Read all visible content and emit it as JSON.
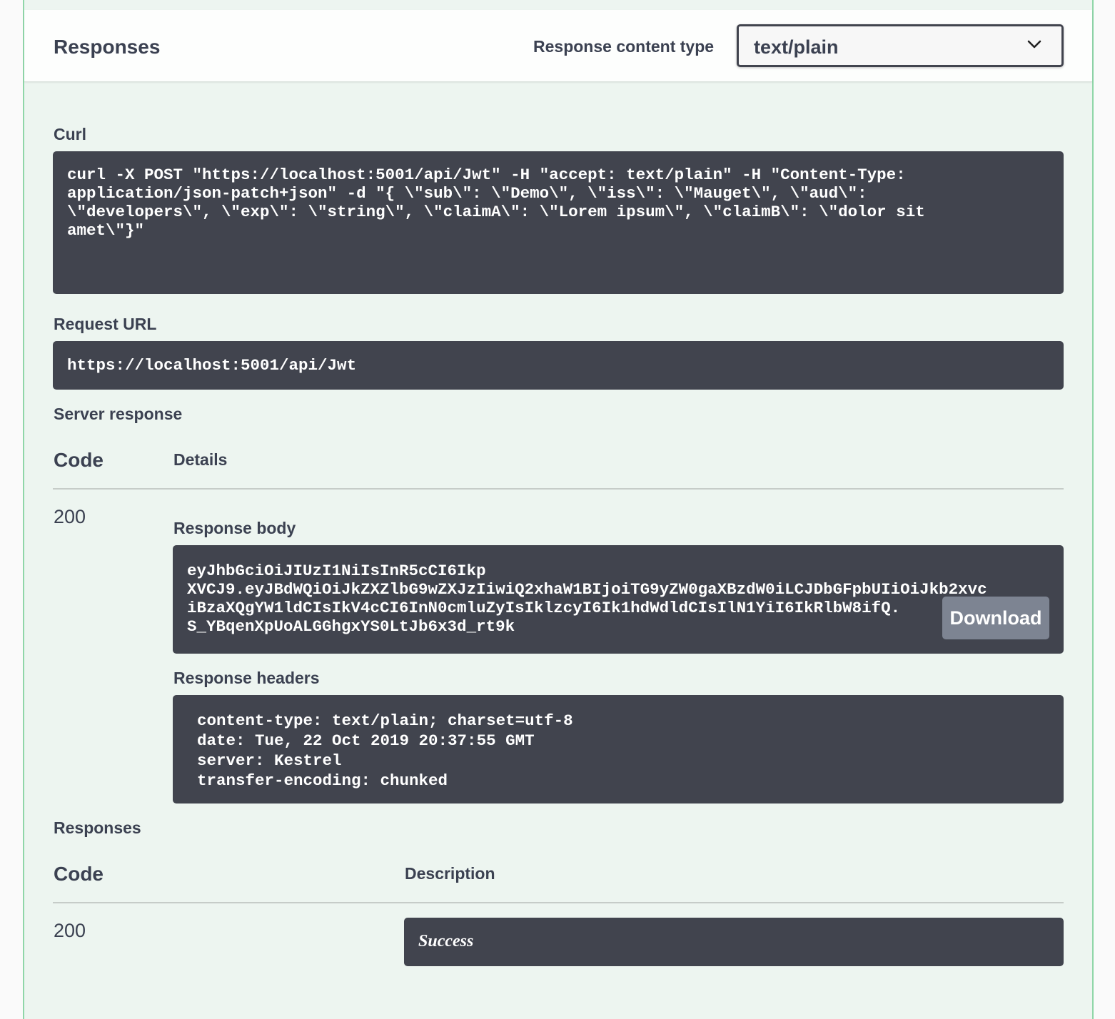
{
  "header": {
    "title": "Responses",
    "content_type_label": "Response content type",
    "content_type_value": "text/plain"
  },
  "curl": {
    "label": "Curl",
    "lines": [
      "curl -X POST \"https://localhost:5001/api/Jwt\" -H \"accept: text/plain\" -H \"Content-Type:",
      "application/json-patch+json\" -d \"{ \\\"sub\\\": \\\"Demo\\\", \\\"iss\\\": \\\"Mauget\\\", \\\"aud\\\":",
      "\\\"developers\\\", \\\"exp\\\": \\\"string\\\", \\\"claimA\\\": \\\"Lorem ipsum\\\", \\\"claimB\\\": \\\"dolor sit",
      "amet\\\"}\""
    ]
  },
  "request_url": {
    "label": "Request URL",
    "value": "https://localhost:5001/api/Jwt"
  },
  "server_response": {
    "label": "Server response",
    "col_code": "Code",
    "col_details": "Details",
    "code": "200",
    "body_label": "Response body",
    "body_lines": [
      "eyJhbGciOiJIUzI1NiIsInR5cCI6Ikp",
      "XVCJ9.eyJBdWQiOiJkZXZlbG9wZXJzIiwiQ2xhaW1BIjoiTG9yZW0gaXBzdW0iLCJDbGFpbUIiOiJkb2xvc",
      "iBzaXQgYW1ldCIsIkV4cCI6InN0cmluZyIsIklzcyI6Ik1hdWdldCIsIlN1YiI6IkRlbW8ifQ.",
      "S_YBqenXpUoALGGhgxYS0LtJb6x3d_rt9k"
    ],
    "download_label": "Download",
    "headers_label": "Response headers",
    "header_lines": [
      "content-type: text/plain; charset=utf-8",
      "date: Tue, 22 Oct 2019 20:37:55 GMT",
      "server: Kestrel",
      "transfer-encoding: chunked"
    ]
  },
  "responses": {
    "label": "Responses",
    "col_code": "Code",
    "col_description": "Description",
    "code": "200",
    "description": "Success"
  },
  "colors": {
    "panel_bg": "#edf5f0",
    "panel_border": "#8fd6a8",
    "code_bg": "#41444e",
    "text": "#3b4151",
    "download_bg": "#7d8492"
  }
}
